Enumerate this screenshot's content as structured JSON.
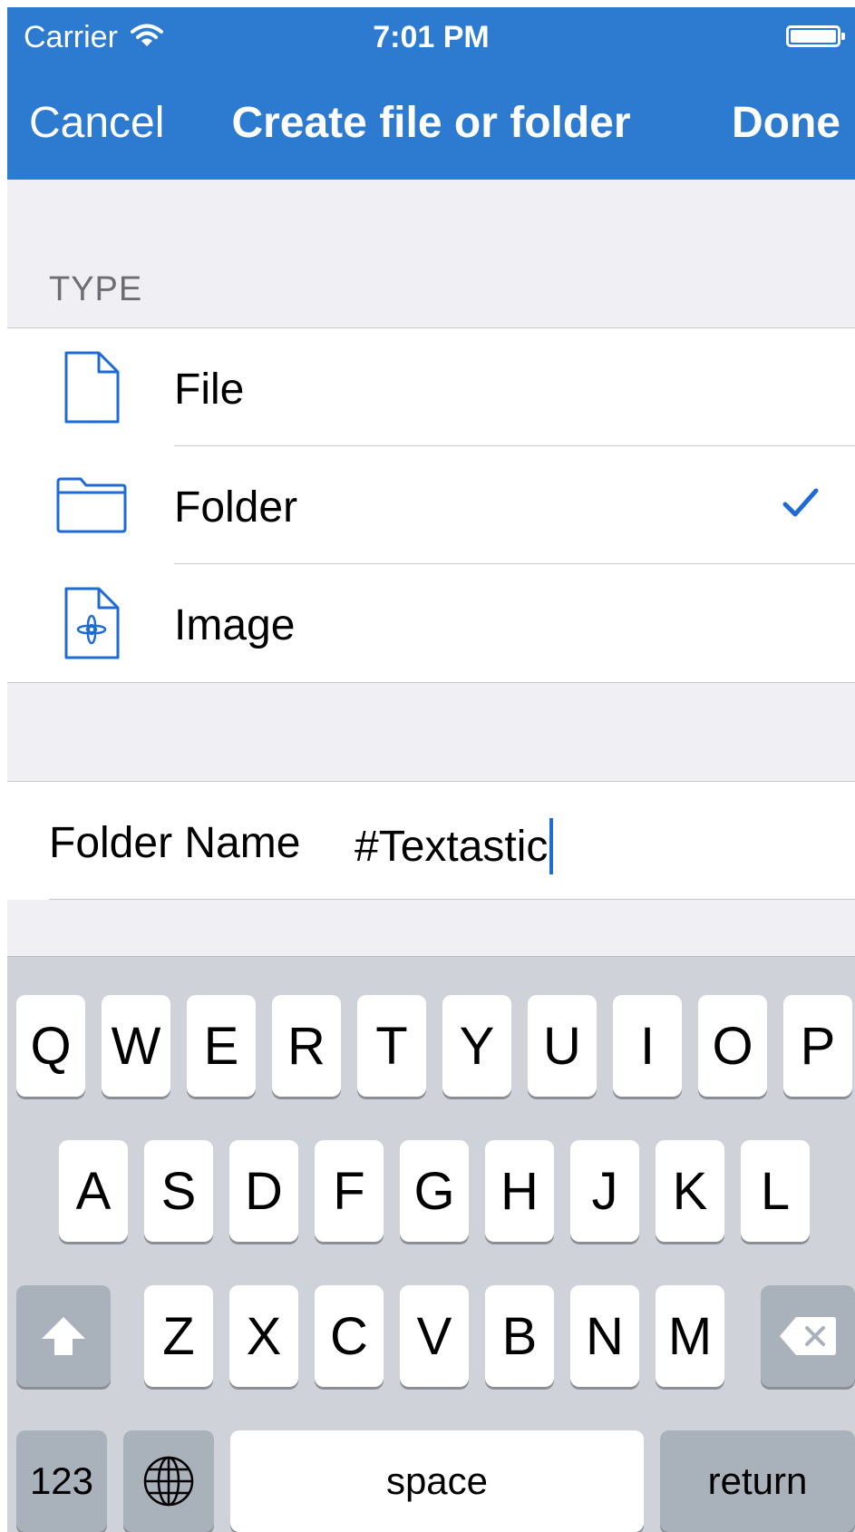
{
  "status_bar": {
    "carrier": "Carrier",
    "time": "7:01 PM"
  },
  "nav": {
    "cancel_label": "Cancel",
    "title": "Create file or folder",
    "done_label": "Done"
  },
  "type_section": {
    "header": "TYPE",
    "items": [
      {
        "label": "File",
        "icon": "file-icon",
        "selected": false
      },
      {
        "label": "Folder",
        "icon": "folder-icon",
        "selected": true
      },
      {
        "label": "Image",
        "icon": "image-file-icon",
        "selected": false
      }
    ]
  },
  "name_field": {
    "label": "Folder Name",
    "value": "#Textastic"
  },
  "keyboard": {
    "row1": [
      "Q",
      "W",
      "E",
      "R",
      "T",
      "Y",
      "U",
      "I",
      "O",
      "P"
    ],
    "row2": [
      "A",
      "S",
      "D",
      "F",
      "G",
      "H",
      "J",
      "K",
      "L"
    ],
    "row3": [
      "Z",
      "X",
      "C",
      "V",
      "B",
      "N",
      "M"
    ],
    "numbers_label": "123",
    "space_label": "space",
    "return_label": "return"
  },
  "colors": {
    "accent": "#2c7bd0",
    "icon": "#1f6bd6",
    "background": "#efeff4"
  }
}
